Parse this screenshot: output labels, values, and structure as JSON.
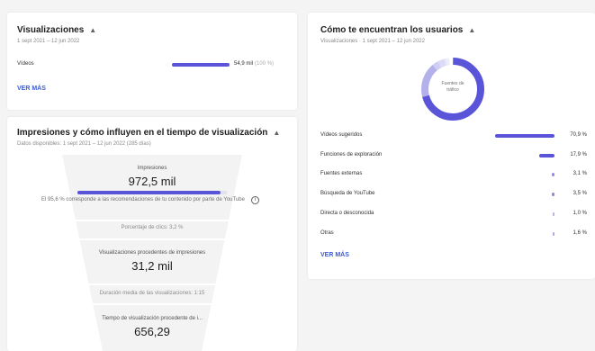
{
  "views_card": {
    "title": "Visualizaciones",
    "date_range": "1 sept 2021 – 12 jun 2022",
    "row_label": "Vídeos",
    "row_value": "54,9 mil",
    "row_value_pct": "(100 %)",
    "bar_fraction": 1.0,
    "see_more": "VER MÁS"
  },
  "impressions_card": {
    "title": "Impresiones y cómo influyen en el tiempo de visualización",
    "date_range": "Datos disponibles: 1 sept 2021 – 12 jun 2022 (285 días)",
    "impressions_label": "Impresiones",
    "impressions_value": "972,5 mil",
    "impressions_bar_fraction": 0.96,
    "recommendation_note": "El 95,6 % corresponde a las recomendaciones de tu contenido por parte de YouTube",
    "ctr_label": "Porcentaje de clics: 3,2 %",
    "views_from_impressions_label": "Visualizaciones procedentes de impresiones",
    "views_from_impressions_value": "31,2 mil",
    "avg_view_duration_label": "Duración media de las visualizaciones: 1:15",
    "watch_time_label": "Tiempo de visualización procedente de i...",
    "watch_time_value": "656,29"
  },
  "traffic_card": {
    "title": "Cómo te encuentran los usuarios",
    "subtitle": "Visualizaciones · 1 sept 2021 – 12 jun 2022",
    "donut_center_label": "Fuentes de tráfico",
    "accent_color": "#5a55d8",
    "rows": [
      {
        "label": "Vídeos sugeridos",
        "value": "70,9 %",
        "fraction": 0.709
      },
      {
        "label": "Funciones de exploración",
        "value": "17,9 %",
        "fraction": 0.179
      },
      {
        "label": "Fuentes externas",
        "value": "3,1 %",
        "fraction": 0.031
      },
      {
        "label": "Búsqueda de YouTube",
        "value": "3,5 %",
        "fraction": 0.035
      },
      {
        "label": "Directa o desconocida",
        "value": "1,0 %",
        "fraction": 0.01
      },
      {
        "label": "Otras",
        "value": "1,6 %",
        "fraction": 0.016
      }
    ],
    "see_more": "VER MÁS"
  }
}
